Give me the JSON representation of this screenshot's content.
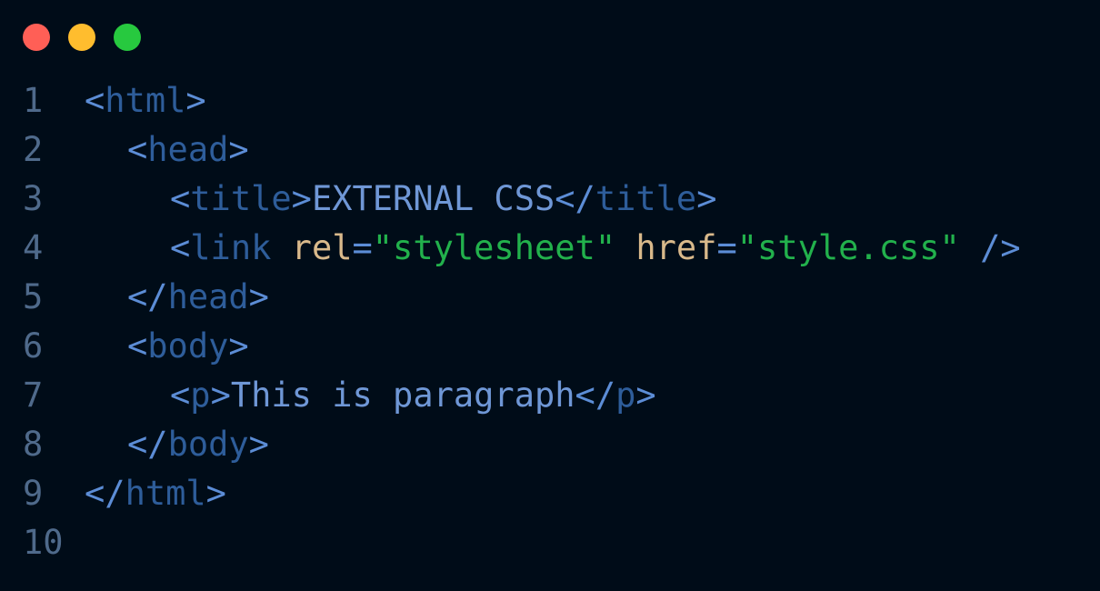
{
  "window": {
    "controls": [
      {
        "name": "close",
        "color": "#ff5f56"
      },
      {
        "name": "minimize",
        "color": "#ffbd2e"
      },
      {
        "name": "zoom",
        "color": "#27c93f"
      }
    ]
  },
  "editor": {
    "lines": [
      {
        "number": "1",
        "indent": 0,
        "tokens": [
          {
            "text": "<",
            "kind": "punct"
          },
          {
            "text": "html",
            "kind": "tag"
          },
          {
            "text": ">",
            "kind": "punct"
          }
        ]
      },
      {
        "number": "2",
        "indent": 1,
        "tokens": [
          {
            "text": "<",
            "kind": "punct"
          },
          {
            "text": "head",
            "kind": "tag"
          },
          {
            "text": ">",
            "kind": "punct"
          }
        ]
      },
      {
        "number": "3",
        "indent": 2,
        "tokens": [
          {
            "text": "<",
            "kind": "punct"
          },
          {
            "text": "title",
            "kind": "tag"
          },
          {
            "text": ">",
            "kind": "punct"
          },
          {
            "text": "EXTERNAL CSS",
            "kind": "text"
          },
          {
            "text": "</",
            "kind": "punct"
          },
          {
            "text": "title",
            "kind": "tag"
          },
          {
            "text": ">",
            "kind": "punct"
          }
        ]
      },
      {
        "number": "4",
        "indent": 2,
        "tokens": [
          {
            "text": "<",
            "kind": "punct"
          },
          {
            "text": "link",
            "kind": "tag"
          },
          {
            "text": " ",
            "kind": "text"
          },
          {
            "text": "rel",
            "kind": "attr"
          },
          {
            "text": "=",
            "kind": "eq"
          },
          {
            "text": "\"stylesheet\"",
            "kind": "str"
          },
          {
            "text": " ",
            "kind": "text"
          },
          {
            "text": "href",
            "kind": "attr"
          },
          {
            "text": "=",
            "kind": "eq"
          },
          {
            "text": "\"style.css\"",
            "kind": "str"
          },
          {
            "text": " ",
            "kind": "text"
          },
          {
            "text": "/>",
            "kind": "punct"
          }
        ]
      },
      {
        "number": "5",
        "indent": 1,
        "tokens": [
          {
            "text": "</",
            "kind": "punct"
          },
          {
            "text": "head",
            "kind": "tag"
          },
          {
            "text": ">",
            "kind": "punct"
          }
        ]
      },
      {
        "number": "6",
        "indent": 1,
        "tokens": [
          {
            "text": "<",
            "kind": "punct"
          },
          {
            "text": "body",
            "kind": "tag"
          },
          {
            "text": ">",
            "kind": "punct"
          }
        ]
      },
      {
        "number": "7",
        "indent": 2,
        "tokens": [
          {
            "text": "<",
            "kind": "punct"
          },
          {
            "text": "p",
            "kind": "tag"
          },
          {
            "text": ">",
            "kind": "punct"
          },
          {
            "text": "This is paragraph",
            "kind": "text"
          },
          {
            "text": "</",
            "kind": "punct"
          },
          {
            "text": "p",
            "kind": "tag"
          },
          {
            "text": ">",
            "kind": "punct"
          }
        ]
      },
      {
        "number": "8",
        "indent": 1,
        "tokens": [
          {
            "text": "</",
            "kind": "punct"
          },
          {
            "text": "body",
            "kind": "tag"
          },
          {
            "text": ">",
            "kind": "punct"
          }
        ]
      },
      {
        "number": "9",
        "indent": 0,
        "tokens": [
          {
            "text": "</",
            "kind": "punct"
          },
          {
            "text": "html",
            "kind": "tag"
          },
          {
            "text": ">",
            "kind": "punct"
          }
        ]
      },
      {
        "number": "10",
        "indent": 0,
        "tokens": []
      }
    ]
  }
}
